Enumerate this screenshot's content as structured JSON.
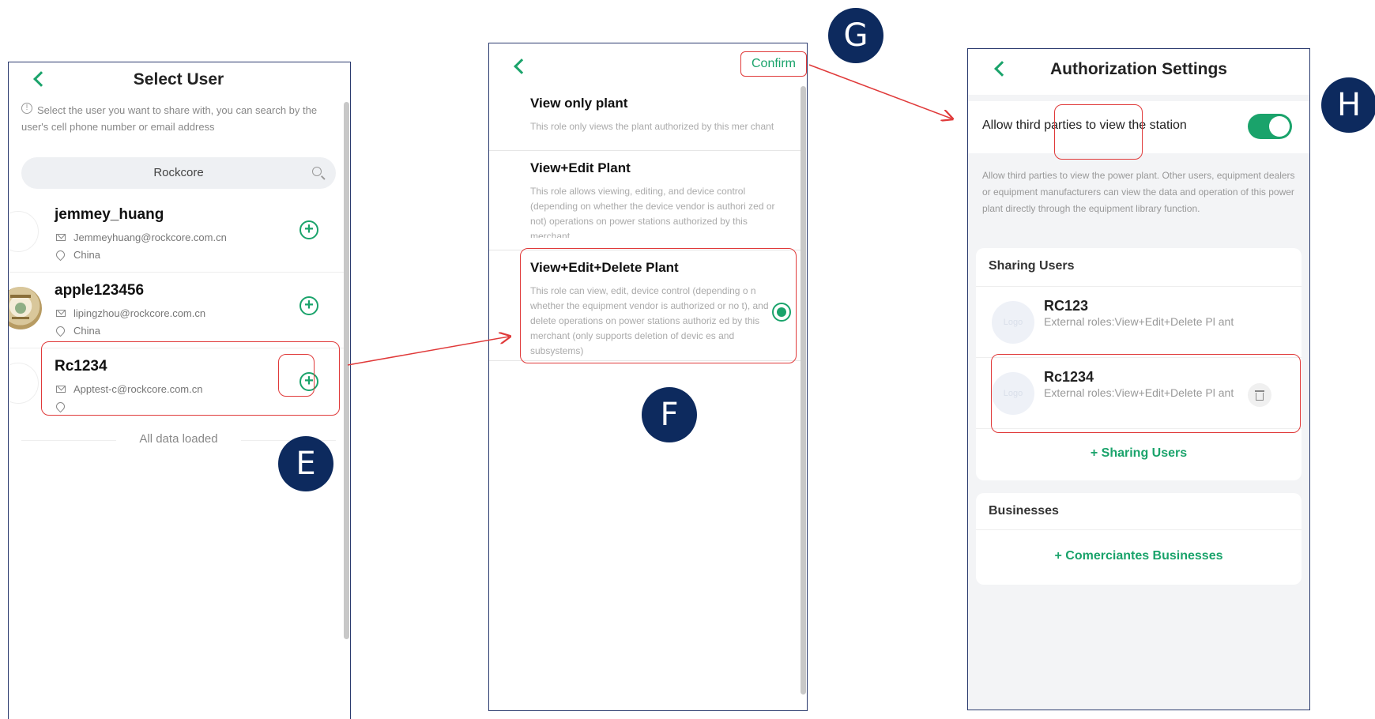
{
  "select_user": {
    "title": "Select User",
    "hint": "Select the user you want to share with, you can search by the user's cell phone number or email address",
    "search_value": "Rockcore",
    "users": [
      {
        "name": "jemmey_huang",
        "email": "Jemmeyhuang@rockcore.com.cn",
        "country": "China"
      },
      {
        "name": "apple123456",
        "email": "lipingzhou@rockcore.com.cn",
        "country": "China"
      },
      {
        "name": "Rc1234",
        "email": "Apptest-c@rockcore.com.cn",
        "country": ""
      }
    ],
    "status": "All data loaded"
  },
  "roles_screen": {
    "confirm_label": "Confirm",
    "roles": [
      {
        "title": "View only plant",
        "desc": "This role only views the plant authorized by this mer chant"
      },
      {
        "title": "View+Edit Plant",
        "desc": "This role allows viewing, editing, and device control (depending on whether the device vendor is authori zed or not) operations on power stations authorized by this merchant"
      },
      {
        "title": "View+Edit+Delete Plant",
        "desc": "This role can view, edit, device control (depending o n whether the equipment vendor is authorized or no t), and delete operations on power stations authoriz ed by this merchant (only supports deletion of devic es and subsystems)"
      }
    ]
  },
  "authorization": {
    "title": "Authorization Settings",
    "allow_label": "Allow third parties to view the station",
    "allow_desc": "Allow third parties to view the power plant. Other users, equipment dealers or equipment manufacturers can view the data and operation of this power plant directly through the equipment library function.",
    "sharing_title": "Sharing Users",
    "sharing_users": [
      {
        "name": "RC123",
        "role": "External roles:View+Edit+Delete Pl ant",
        "logo": "Logo"
      },
      {
        "name": "Rc1234",
        "role": "External roles:View+Edit+Delete Pl ant",
        "logo": "Logo"
      }
    ],
    "add_sharing": "+ Sharing Users",
    "businesses_title": "Businesses",
    "add_business": "+ Comerciantes Businesses"
  },
  "badges": {
    "e": "E",
    "f": "F",
    "g": "G",
    "h": "H"
  },
  "colors": {
    "accent": "#1aa36b",
    "highlight": "#e03a3a",
    "badge": "#0d2a5e"
  },
  "icons": [
    "back-chevron-icon",
    "info-icon",
    "search-icon",
    "mail-icon",
    "location-pin-icon",
    "add-circle-icon",
    "radio-selected-icon",
    "toggle-on",
    "trash-icon"
  ]
}
